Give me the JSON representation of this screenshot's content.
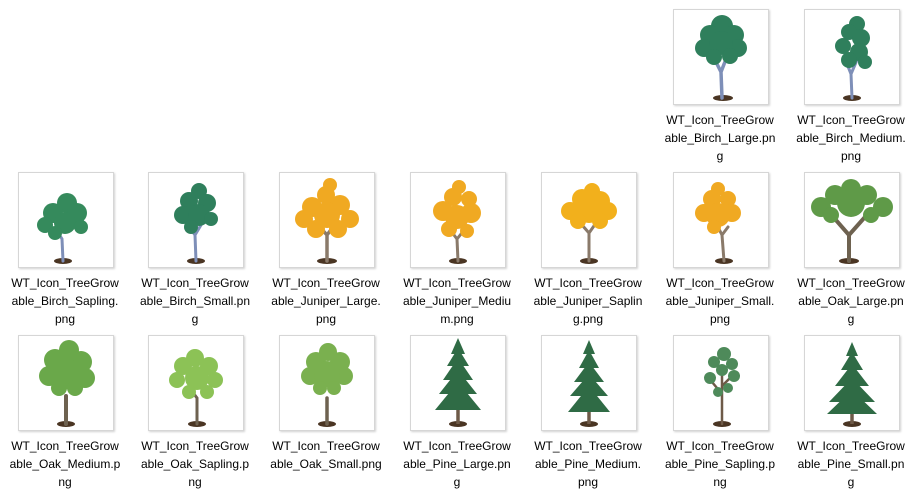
{
  "files": [
    {
      "name": "WT_Icon_TreeGrowable_Birch_Large.png",
      "tree": "birch-large-tree-icon",
      "foliage": "#2f7f5c"
    },
    {
      "name": "WT_Icon_TreeGrowable_Birch_Medium.png",
      "tree": "birch-medium-tree-icon",
      "foliage": "#2f7f5c"
    },
    {
      "name": "WT_Icon_TreeGrowable_Birch_Sapling.png",
      "tree": "birch-sapling-tree-icon",
      "foliage": "#358a5c"
    },
    {
      "name": "WT_Icon_TreeGrowable_Birch_Small.png",
      "tree": "birch-small-tree-icon",
      "foliage": "#2f7f5c"
    },
    {
      "name": "WT_Icon_TreeGrowable_Juniper_Large.png",
      "tree": "juniper-large-tree-icon",
      "foliage": "#f0a922"
    },
    {
      "name": "WT_Icon_TreeGrowable_Juniper_Medium.png",
      "tree": "juniper-medium-tree-icon",
      "foliage": "#f0a922"
    },
    {
      "name": "WT_Icon_TreeGrowable_Juniper_Sapling.png",
      "tree": "juniper-sapling-tree-icon",
      "foliage": "#f2b01c"
    },
    {
      "name": "WT_Icon_TreeGrowable_Juniper_Small.png",
      "tree": "juniper-small-tree-icon",
      "foliage": "#f0a922"
    },
    {
      "name": "WT_Icon_TreeGrowable_Oak_Large.png",
      "tree": "oak-large-tree-icon",
      "foliage": "#5f9a48"
    },
    {
      "name": "WT_Icon_TreeGrowable_Oak_Medium.png",
      "tree": "oak-medium-tree-icon",
      "foliage": "#6aa84a"
    },
    {
      "name": "WT_Icon_TreeGrowable_Oak_Sapling.png",
      "tree": "oak-sapling-tree-icon",
      "foliage": "#8cc256"
    },
    {
      "name": "WT_Icon_TreeGrowable_Oak_Small.png",
      "tree": "oak-small-tree-icon",
      "foliage": "#7ab04f"
    },
    {
      "name": "WT_Icon_TreeGrowable_Pine_Large.png",
      "tree": "pine-large-tree-icon",
      "foliage": "#2f6b45"
    },
    {
      "name": "WT_Icon_TreeGrowable_Pine_Medium.png",
      "tree": "pine-medium-tree-icon",
      "foliage": "#2f6b45"
    },
    {
      "name": "WT_Icon_TreeGrowable_Pine_Sapling.png",
      "tree": "pine-sapling-tree-icon",
      "foliage": "#4e8a5a"
    },
    {
      "name": "WT_Icon_TreeGrowable_Pine_Small.png",
      "tree": "pine-small-tree-icon",
      "foliage": "#2f6b45"
    }
  ]
}
